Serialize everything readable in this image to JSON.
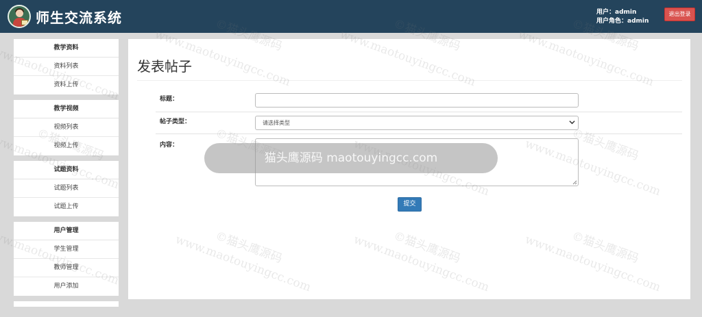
{
  "header": {
    "app_title": "师生交流系统",
    "user_line": "用户：admin",
    "role_line": "用户角色：admin",
    "logout_label": "退出登录",
    "bg_color": "#24445c"
  },
  "sidebar": {
    "groups": [
      {
        "title": "教学资料",
        "items": [
          "资料列表",
          "资料上传"
        ]
      },
      {
        "title": "教学视频",
        "items": [
          "视频列表",
          "视频上传"
        ]
      },
      {
        "title": "试题资料",
        "items": [
          "试题列表",
          "试题上传"
        ]
      },
      {
        "title": "用户管理",
        "items": [
          "学生管理",
          "教师管理",
          "用户添加"
        ]
      }
    ]
  },
  "main": {
    "page_title": "发表帖子",
    "form": {
      "title_label": "标题：",
      "title_value": "",
      "type_label": "帖子类型：",
      "type_selected": "请选择类型",
      "content_label": "内容：",
      "content_value": ""
    },
    "submit_label": "提交",
    "submit_color": "#337ab7"
  },
  "watermark": {
    "text_cn": "©猫头鹰源码",
    "text_url": "www.maotouyingcc.com",
    "banner": "猫头鹰源码 maotouyingcc.com"
  }
}
